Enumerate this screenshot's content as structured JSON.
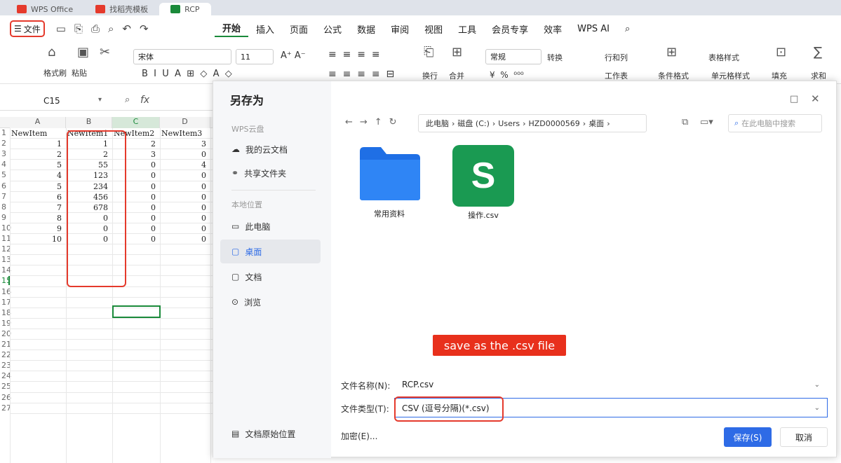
{
  "tabs": [
    {
      "label": "WPS Office",
      "color": "#e53a2c"
    },
    {
      "label": "找稻壳模板",
      "color": "#e53a2c"
    },
    {
      "label": "RCP",
      "color": "#1a8a3a"
    }
  ],
  "menubar": {
    "file_label": "文件",
    "menus": [
      "开始",
      "插入",
      "页面",
      "公式",
      "数据",
      "审阅",
      "视图",
      "工具",
      "会员专享",
      "效率",
      "WPS AI"
    ],
    "active_menu": "开始"
  },
  "ribbon": {
    "format_painter": "格式刷",
    "paste": "粘贴",
    "font_name": "宋体",
    "font_size": "11",
    "wrap": "换行",
    "merge": "合并",
    "number_format": "常规",
    "convert": "转换",
    "rows_cols": "行和列",
    "worksheet": "工作表",
    "conditional_format": "条件格式",
    "table_style": "表格样式",
    "cell_style": "单元格样式",
    "fill": "填充",
    "sum": "求和"
  },
  "formula_bar": {
    "cell_ref": "C15",
    "fx": "fx"
  },
  "sheet": {
    "columns": [
      "A",
      "B",
      "C",
      "D"
    ],
    "headers": [
      "NewItem",
      "NewItem1",
      "NewItem2",
      "NewItem3"
    ],
    "rows": [
      [
        "1",
        "1",
        "2",
        "3"
      ],
      [
        "2",
        "2",
        "3",
        "0"
      ],
      [
        "5",
        "55",
        "0",
        "4"
      ],
      [
        "4",
        "123",
        "0",
        "0"
      ],
      [
        "5",
        "234",
        "0",
        "0"
      ],
      [
        "6",
        "456",
        "0",
        "0"
      ],
      [
        "7",
        "678",
        "0",
        "0"
      ],
      [
        "8",
        "0",
        "0",
        "0"
      ],
      [
        "9",
        "0",
        "0",
        "0"
      ],
      [
        "10",
        "0",
        "0",
        "0"
      ]
    ],
    "row_numbers": [
      "1",
      "2",
      "3",
      "4",
      "5",
      "6",
      "7",
      "8",
      "9",
      "10",
      "11",
      "12",
      "13",
      "14",
      "15",
      "16",
      "17",
      "18",
      "19",
      "20",
      "21",
      "22",
      "23",
      "24",
      "25",
      "26",
      "27"
    ]
  },
  "dialog": {
    "title": "另存为",
    "cloud_header": "WPS云盘",
    "cloud_items": [
      "我的云文档",
      "共享文件夹"
    ],
    "local_header": "本地位置",
    "local_items": [
      "此电脑",
      "桌面",
      "文档",
      "浏览"
    ],
    "active_item": "桌面",
    "original_location": "文档原始位置",
    "breadcrumb": [
      "此电脑",
      "磁盘 (C:)",
      "Users",
      "HZD0000569",
      "桌面"
    ],
    "search_placeholder": "在此电脑中搜索",
    "files": [
      {
        "name": "常用资料",
        "type": "folder"
      },
      {
        "name": "操作.csv",
        "type": "sheet"
      }
    ],
    "filename_label": "文件名称(N):",
    "filename_value": "RCP.csv",
    "filetype_label": "文件类型(T):",
    "filetype_value": "CSV (逗号分隔)(*.csv)",
    "encrypt_label": "加密(E)...",
    "save_label": "保存(S)",
    "cancel_label": "取消"
  },
  "annotation": "save as the .csv file",
  "colors": {
    "accent": "#2e6be6",
    "highlight": "#e53a2c",
    "brand_green": "#1a8a3a"
  }
}
